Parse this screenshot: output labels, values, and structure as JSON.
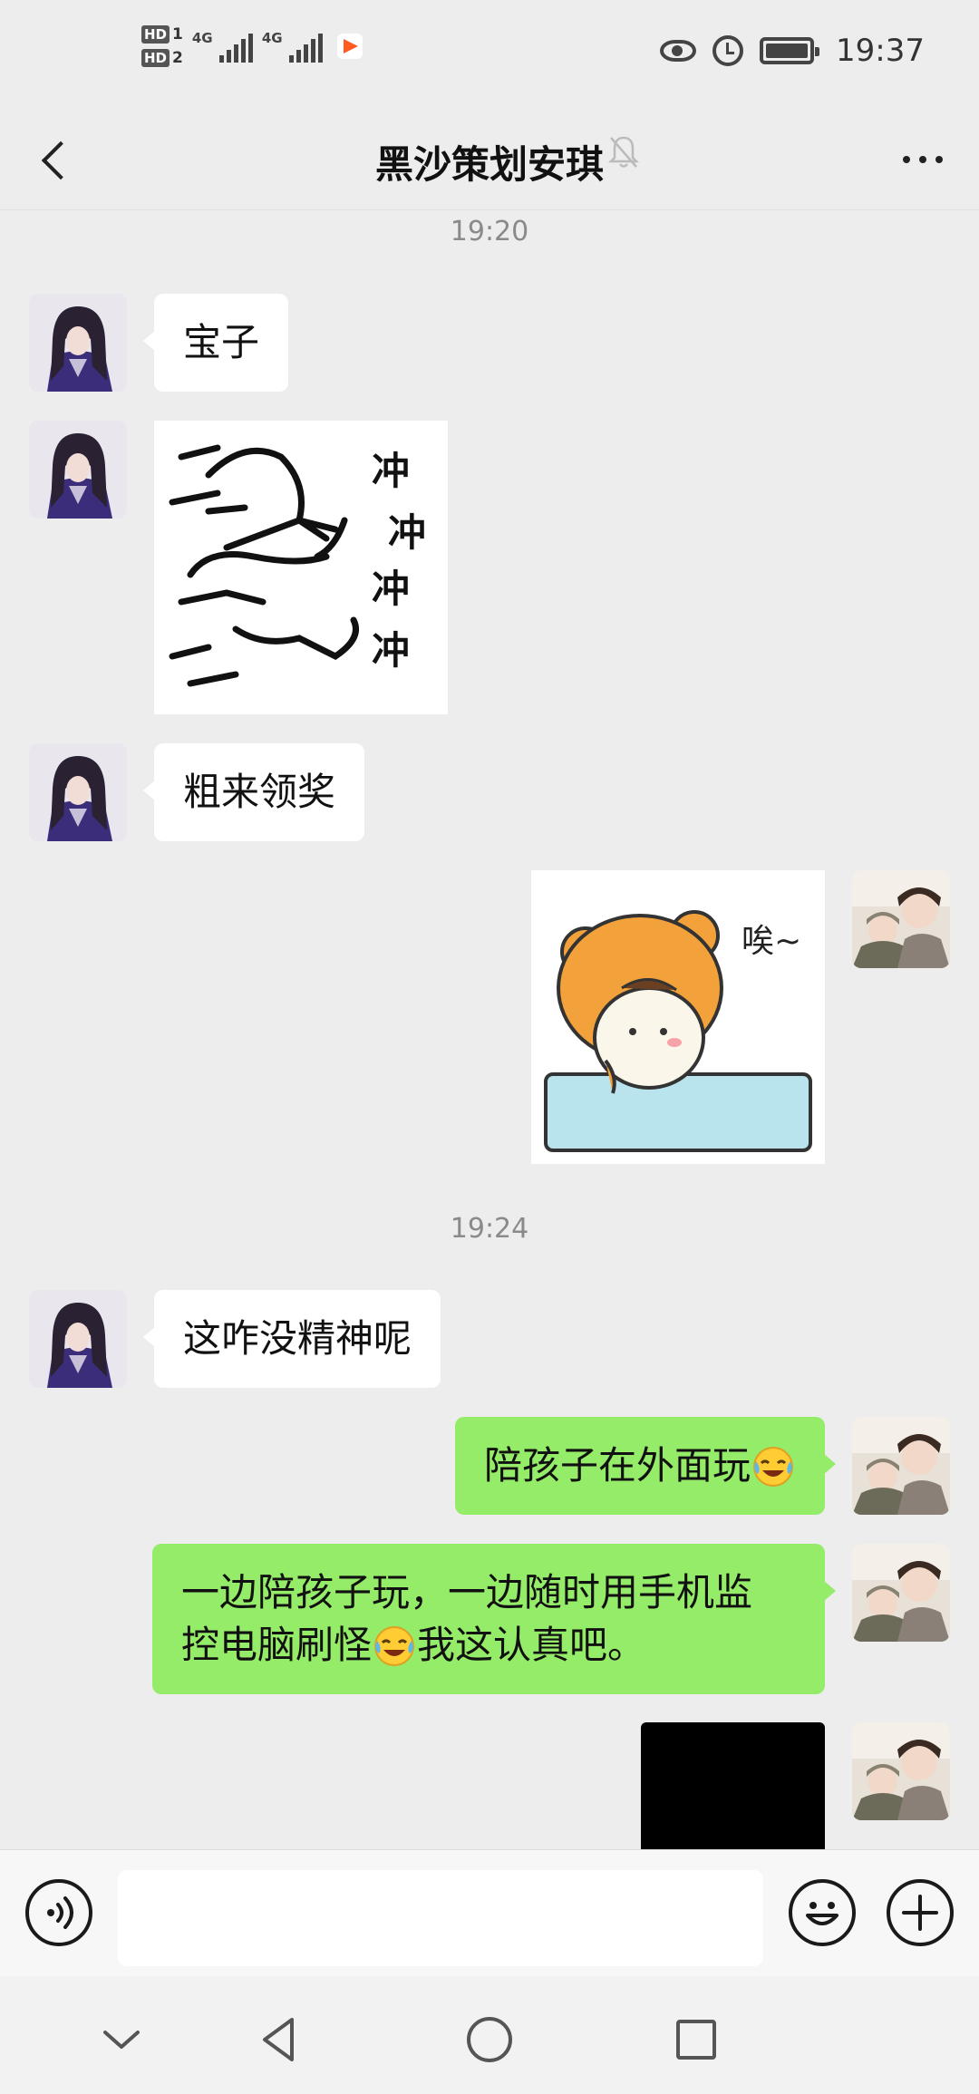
{
  "status_bar": {
    "sim1": {
      "tag": "HD",
      "num": "1"
    },
    "sim2": {
      "tag": "HD",
      "num": "2"
    },
    "network1": "4G",
    "network2": "4G",
    "time": "19:37"
  },
  "header": {
    "title": "黑沙策划安琪"
  },
  "messages": {
    "time1": "19:20",
    "m1": "宝子",
    "m2_sticker": {
      "lines": [
        "冲",
        "冲",
        "冲",
        "冲"
      ]
    },
    "m3": "粗来领奖",
    "m4_sticker": {
      "text": "唉~"
    },
    "time2": "19:24",
    "m5": "这咋没精神呢",
    "m6": "陪孩子在外面玩",
    "m7_line1": "一边陪孩子玩，一边随时用手机监",
    "m7_line2a": "控电脑刷怪",
    "m7_line2b": "我这认真吧。"
  },
  "input": {
    "value": "",
    "placeholder": ""
  },
  "colors": {
    "background": "#ededed",
    "bubble_self": "#95ec69",
    "bubble_other": "#ffffff"
  }
}
